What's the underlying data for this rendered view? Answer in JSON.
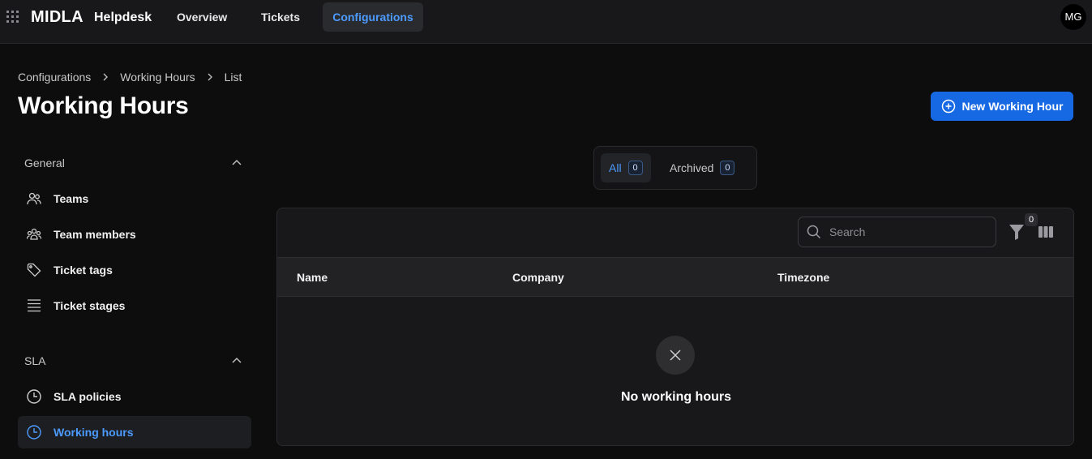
{
  "topbar": {
    "logo": "MIDLA",
    "product": "Helpdesk",
    "nav": [
      "Overview",
      "Tickets",
      "Configurations"
    ],
    "active_nav": "Configurations",
    "user_initials": "MG"
  },
  "breadcrumb": [
    "Configurations",
    "Working Hours",
    "List"
  ],
  "page_title": "Working Hours",
  "new_button_label": "New Working Hour",
  "sidebar": {
    "sections": [
      {
        "title": "General",
        "items": [
          "Teams",
          "Team members",
          "Ticket tags",
          "Ticket stages"
        ]
      },
      {
        "title": "SLA",
        "items": [
          "SLA policies",
          "Working hours"
        ]
      }
    ],
    "active_item": "Working hours"
  },
  "tabs": [
    {
      "label": "All",
      "count": "0"
    },
    {
      "label": "Archived",
      "count": "0"
    }
  ],
  "table": {
    "search_placeholder": "Search",
    "filter_count": "0",
    "columns": [
      "Name",
      "Company",
      "Timezone"
    ],
    "empty_message": "No working hours"
  },
  "colors": {
    "accent": "#4c9bff",
    "primary_button": "#1668e3",
    "background": "#0d0d0e",
    "panel": "#18181a"
  }
}
